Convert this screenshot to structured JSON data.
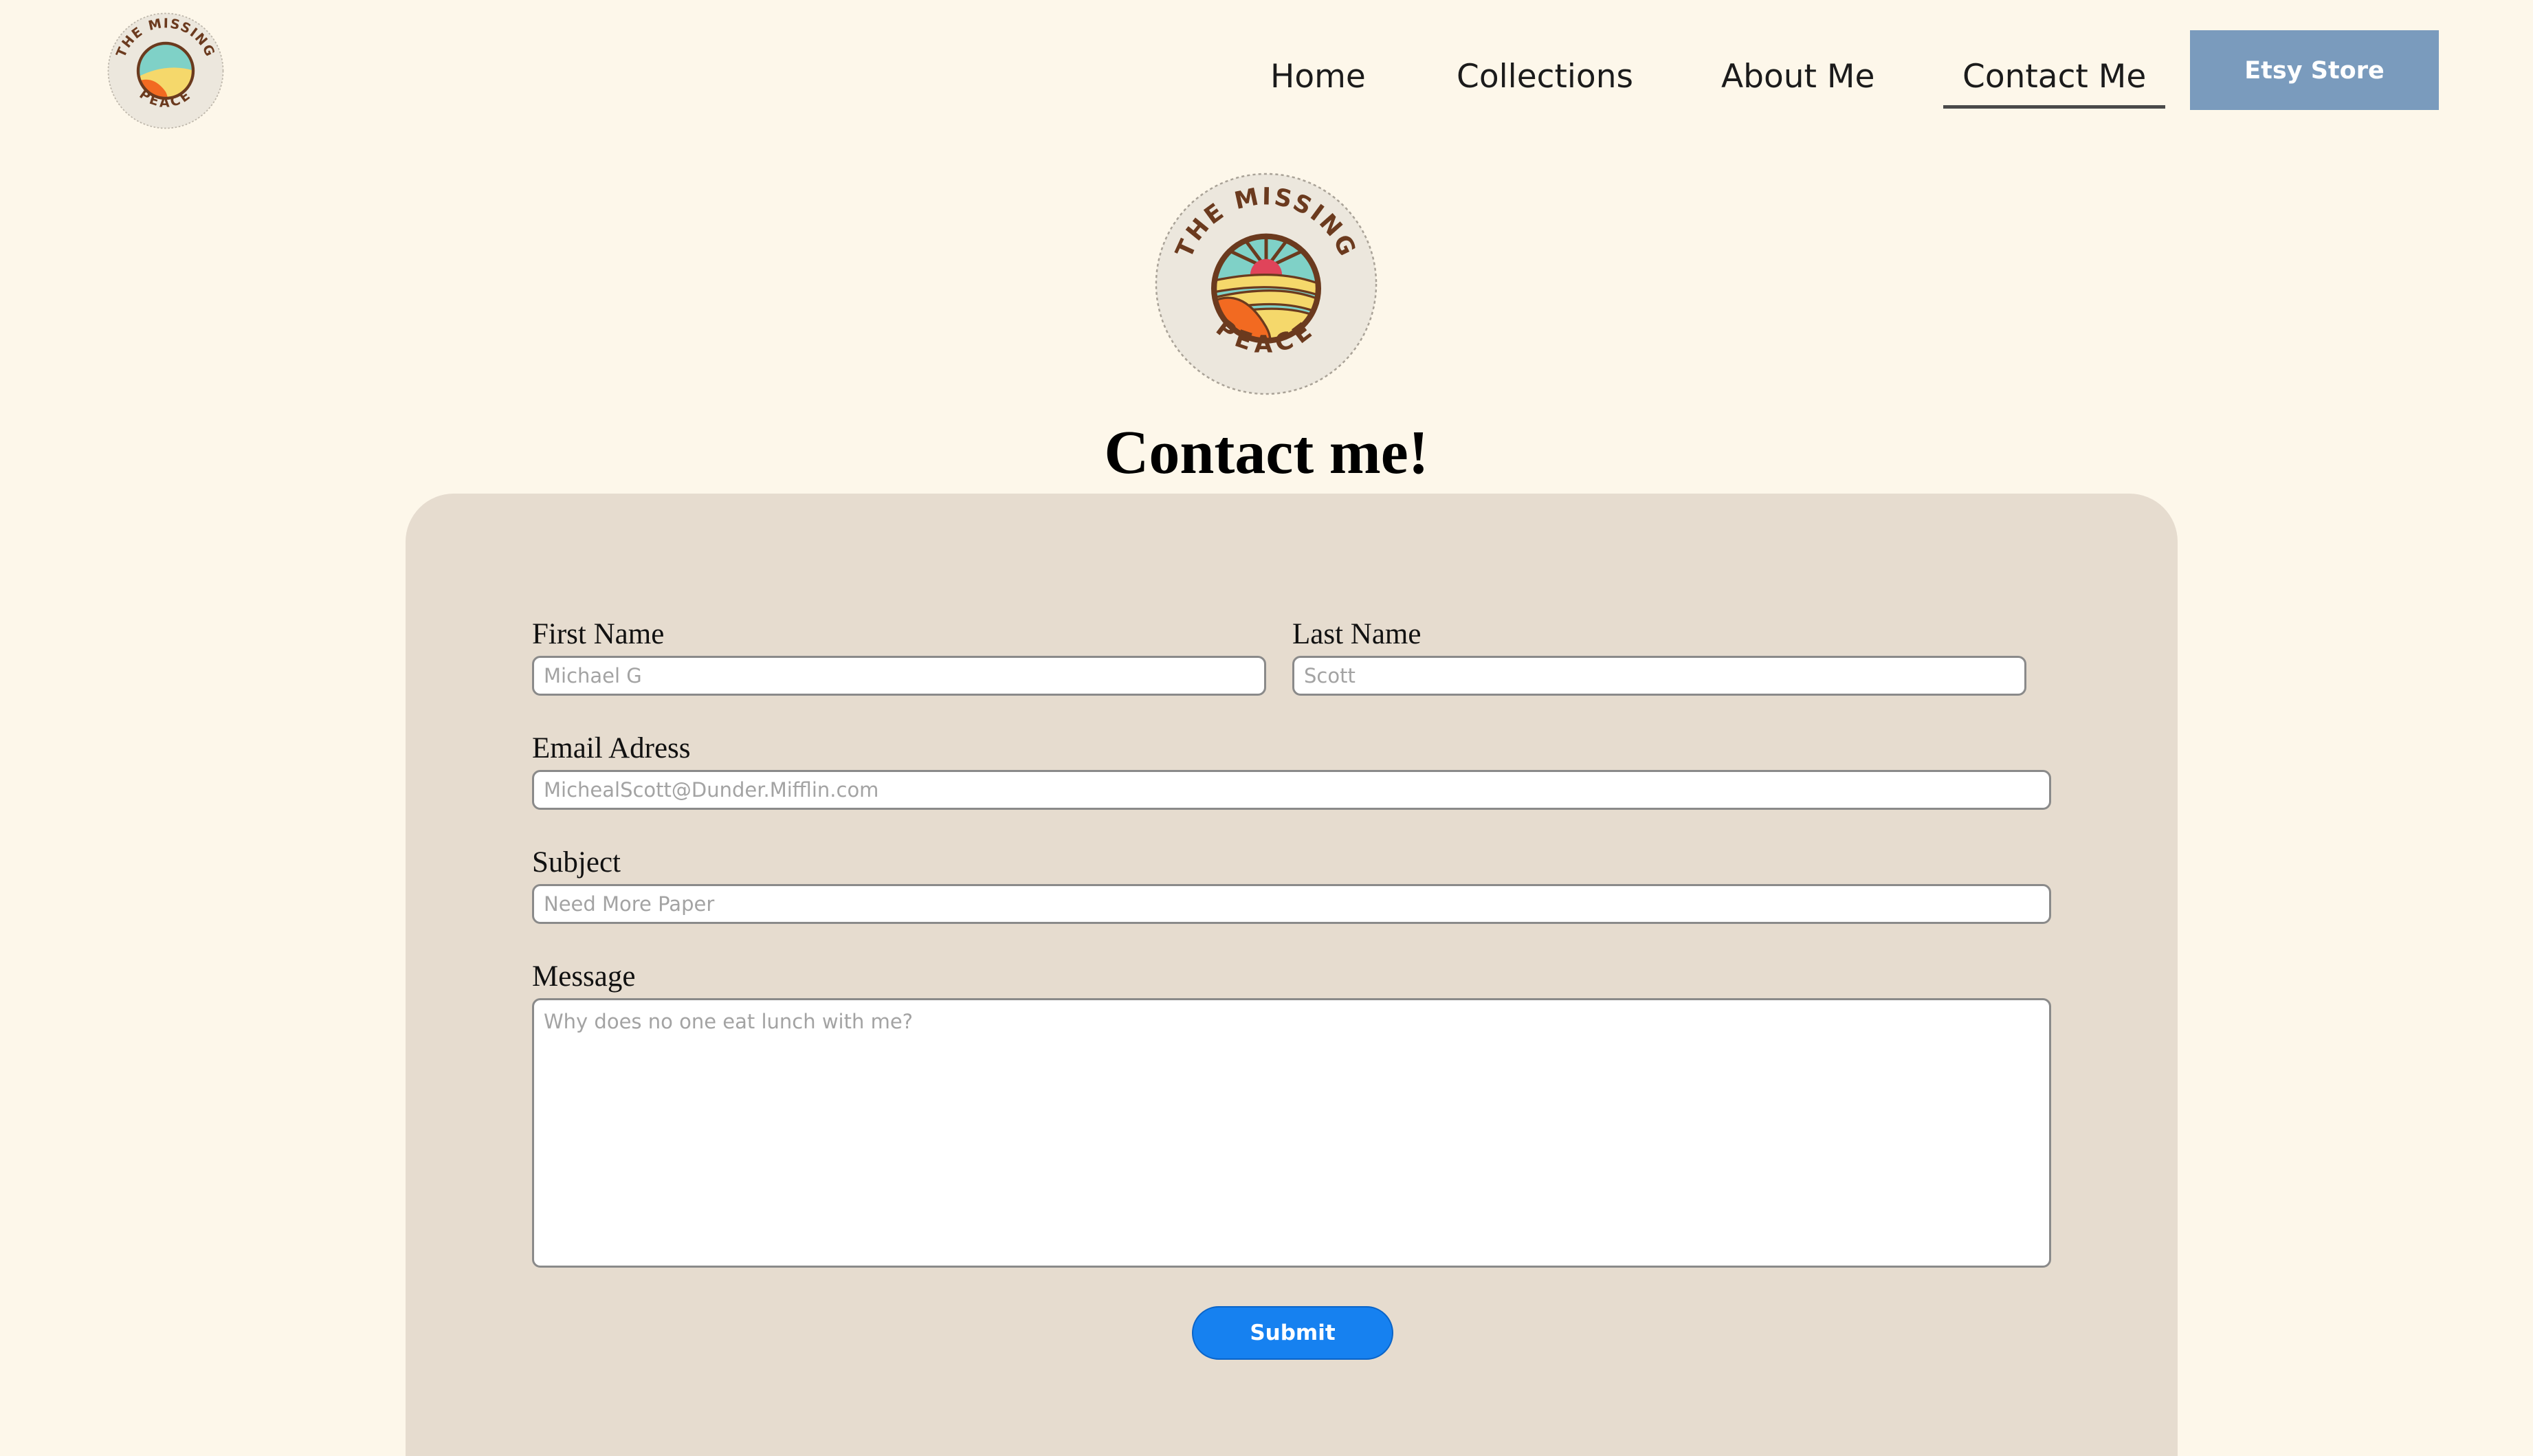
{
  "brand": {
    "logo_text_top": "THE MISSING",
    "logo_text_bottom": "PEACE"
  },
  "nav": {
    "items": [
      {
        "label": "Home",
        "active": false
      },
      {
        "label": "Collections",
        "active": false
      },
      {
        "label": "About Me",
        "active": false
      },
      {
        "label": "Contact Me",
        "active": true
      }
    ],
    "etsy_button_label": "Etsy Store"
  },
  "page": {
    "title": "Contact me!"
  },
  "form": {
    "first_name": {
      "label": "First Name",
      "placeholder": "Michael G"
    },
    "last_name": {
      "label": "Last Name",
      "placeholder": "Scott"
    },
    "email": {
      "label": "Email Adress",
      "placeholder": "MichealScott@Dunder.Mifflin.com"
    },
    "subject": {
      "label": "Subject",
      "placeholder": "Need More Paper"
    },
    "message": {
      "label": "Message",
      "placeholder": "Why does no one eat lunch with me?"
    },
    "submit_label": "Submit"
  },
  "colors": {
    "page_background": "#fdf7ea",
    "card_background": "#e6dccf",
    "etsy_button": "#7a9bbd",
    "submit_button": "#1681f0",
    "logo_orange": "#f26a21",
    "logo_teal": "#7fd1c7",
    "logo_yellow": "#f5d86b",
    "logo_brown": "#6b3a1e"
  }
}
